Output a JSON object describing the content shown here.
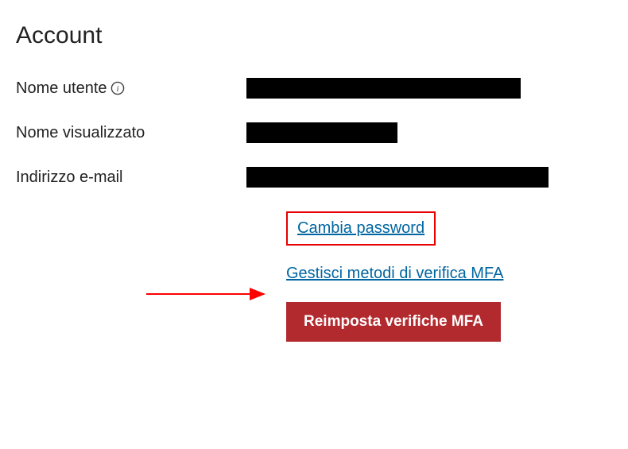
{
  "heading": "Account",
  "fields": {
    "username_label": "Nome utente",
    "displayname_label": "Nome visualizzato",
    "email_label": "Indirizzo e-mail"
  },
  "actions": {
    "change_password": "Cambia password",
    "manage_mfa": "Gestisci metodi di verifica MFA",
    "reset_mfa": "Reimposta verifiche MFA"
  },
  "colors": {
    "link": "#0066a1",
    "highlight_border": "#e60000",
    "button_bg": "#b2292e"
  }
}
